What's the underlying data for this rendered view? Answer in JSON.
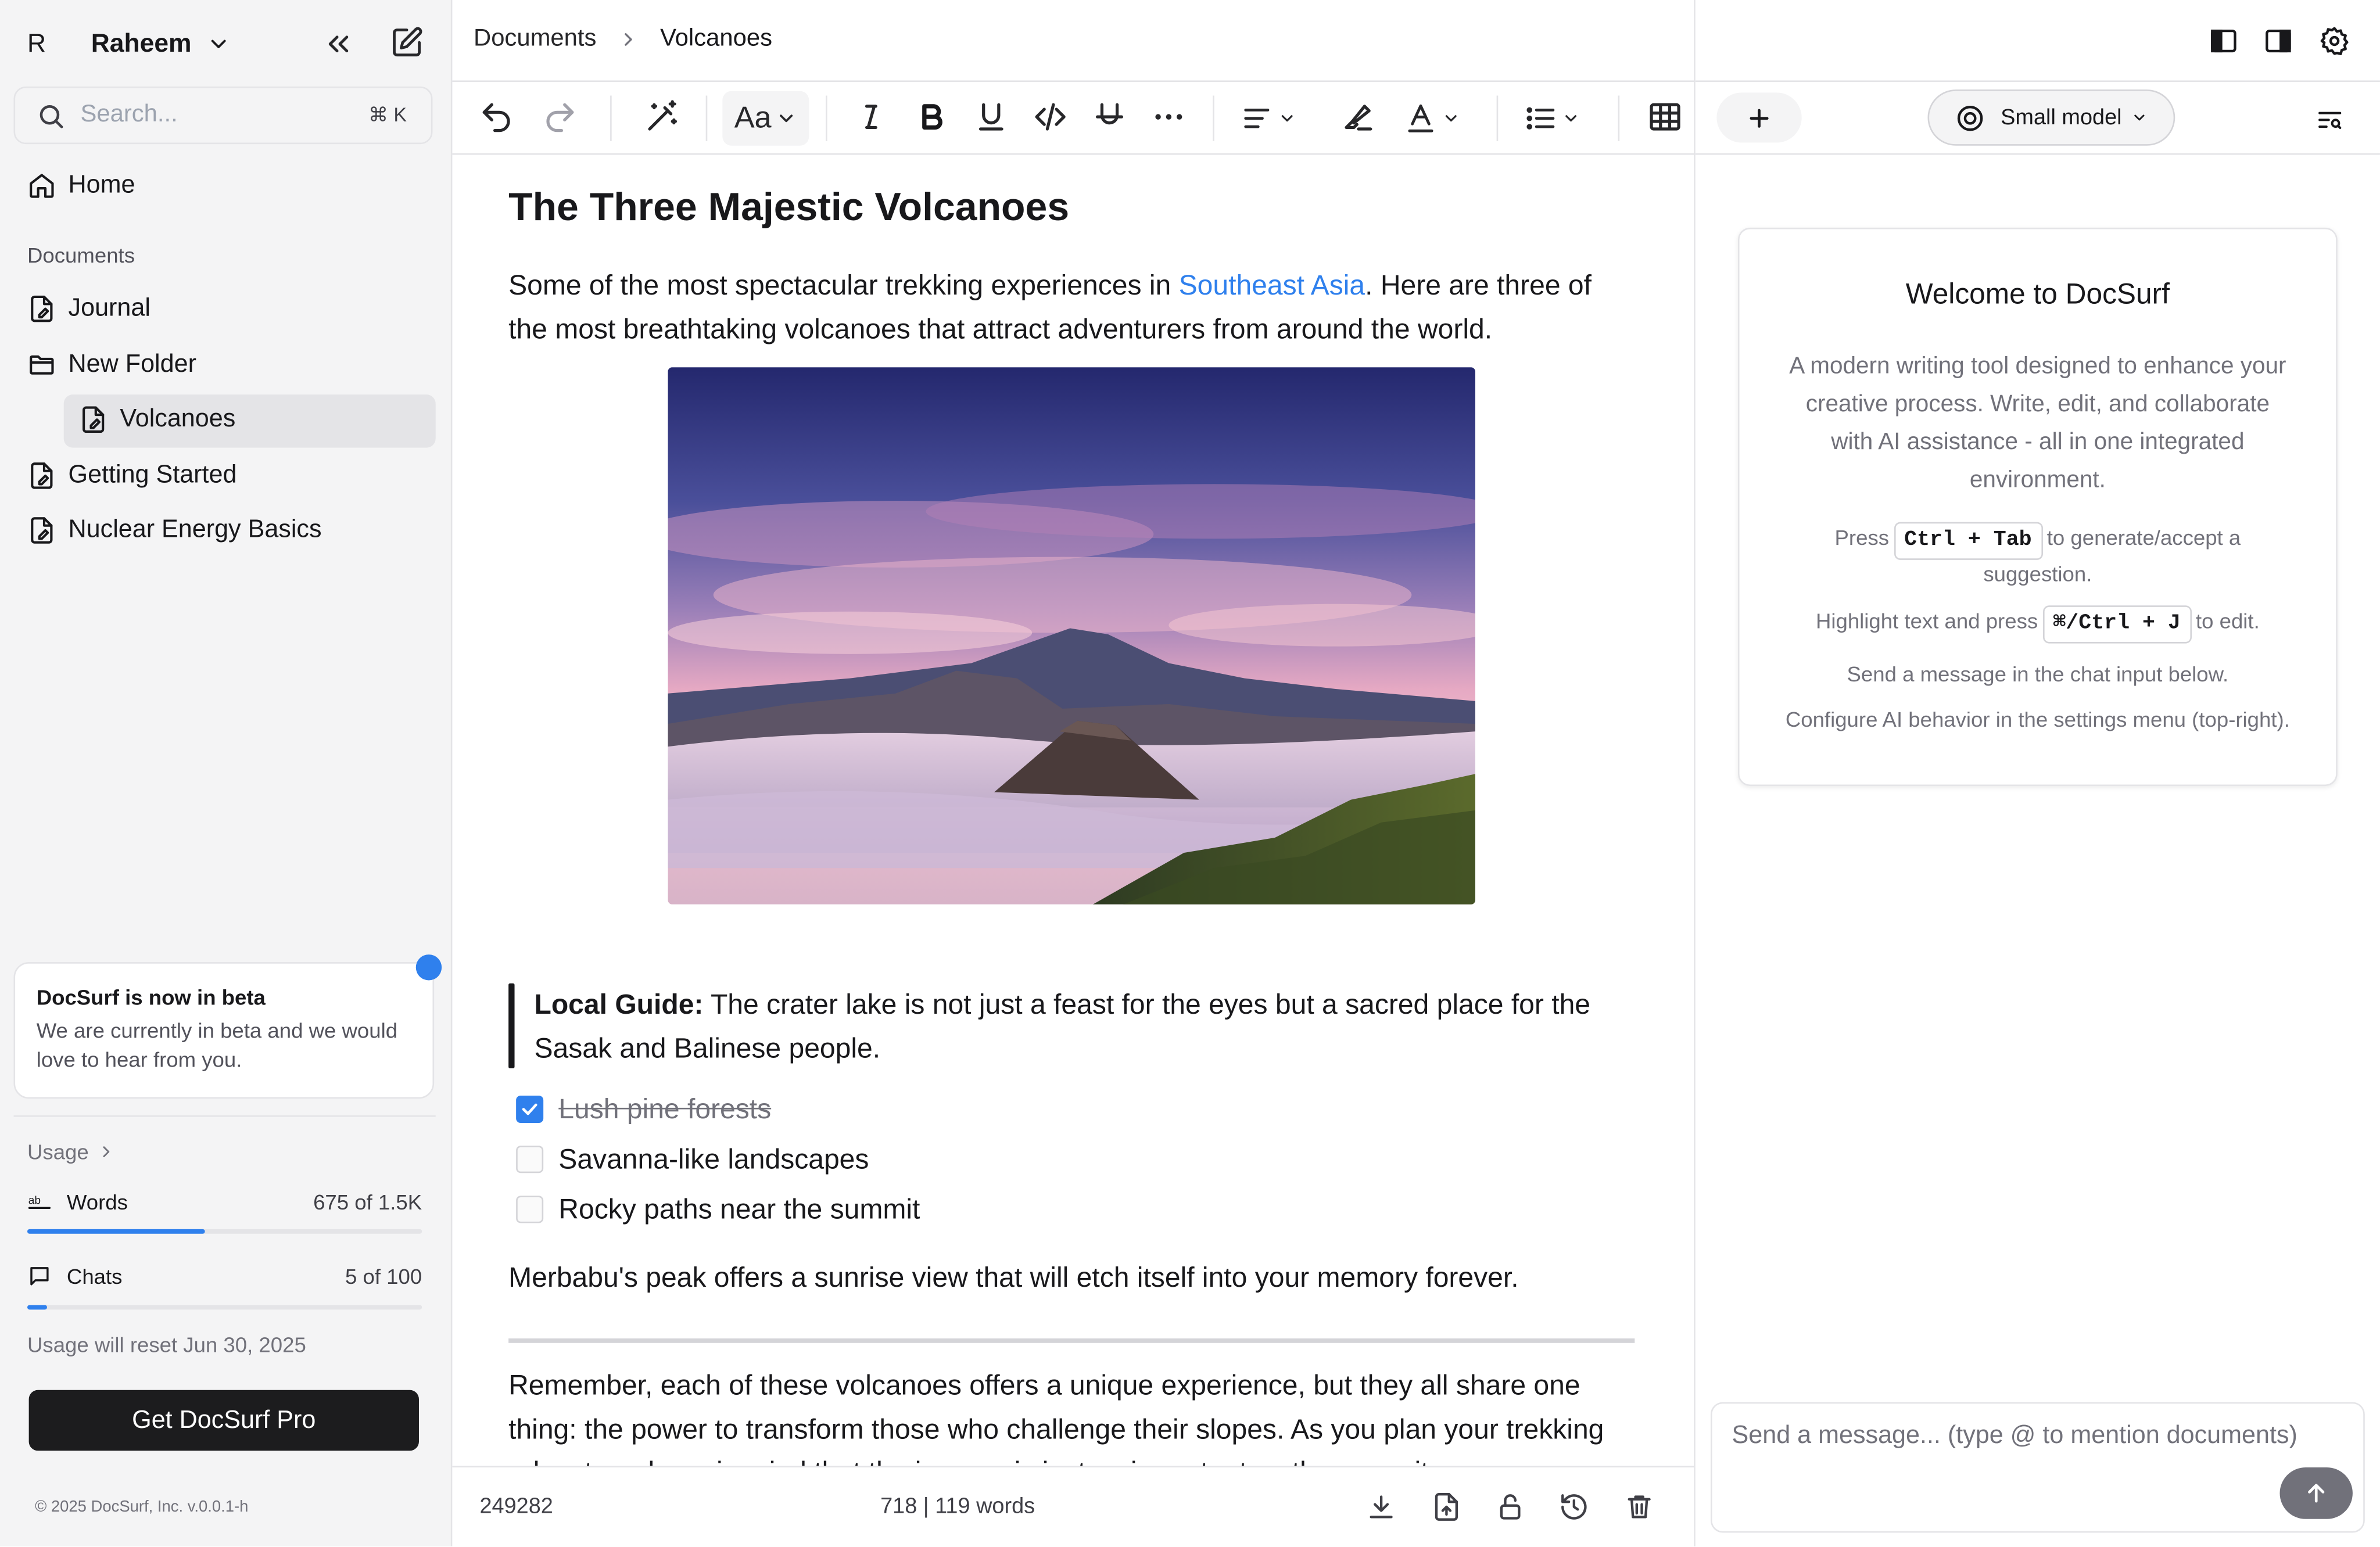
{
  "sidebar": {
    "avatar_letter": "R",
    "user_name": "Raheem",
    "search_placeholder": "Search...",
    "search_shortcut": "⌘ K",
    "home_label": "Home",
    "documents_label": "Documents",
    "items": [
      {
        "label": "Journal"
      },
      {
        "label": "New Folder"
      },
      {
        "label": "Volcanoes"
      },
      {
        "label": "Getting Started"
      },
      {
        "label": "Nuclear Energy Basics"
      }
    ],
    "beta": {
      "title": "DocSurf is now in beta",
      "text": "We are currently in beta and we would love to hear from you."
    },
    "usage": {
      "label": "Usage",
      "words_label": "Words",
      "words_value": "675 of 1.5K",
      "words_fraction": 0.45,
      "chats_label": "Chats",
      "chats_value": "5 of 100",
      "chats_fraction": 0.05,
      "reset_text": "Usage will reset Jun 30, 2025"
    },
    "pro_button": "Get DocSurf Pro",
    "copyright": "© 2025 DocSurf, Inc. v.0.0.1-h"
  },
  "main": {
    "breadcrumb": [
      "Documents",
      "Volcanoes"
    ],
    "toolbar": {
      "font_button": "Aa"
    },
    "doc": {
      "title": "The Three Majestic Volcanoes",
      "intro_before": "Some of the most spectacular trekking experiences in ",
      "intro_link": "Southeast Asia",
      "intro_after": ". Here are three of the most breathtaking volcanoes that attract adventurers from around the world.",
      "quote_bold": "Local Guide:",
      "quote_text": " The crater lake is not just a feast for the eyes but a sacred place for the Sasak and Balinese people.",
      "tasks": [
        {
          "label": "Lush pine forests",
          "checked": true
        },
        {
          "label": "Savanna-like landscapes",
          "checked": false
        },
        {
          "label": "Rocky paths near the summit",
          "checked": false
        }
      ],
      "summit_text": "Merbabu's peak offers a sunrise view that will etch itself into your memory forever.",
      "closing_text": "Remember, each of these volcanoes offers a unique experience, but they all share one thing: the power to transform those who challenge their slopes. As you plan your trekking adventure, keep in mind that the journey is just as important as the summit."
    },
    "status": {
      "doc_id": "249282",
      "counts": "718 | 119 words"
    }
  },
  "right_panel": {
    "model_label": "Small model",
    "welcome": {
      "title": "Welcome to DocSurf",
      "description": "A modern writing tool designed to enhance your creative process. Write, edit, and collaborate with AI assistance - all in one integrated environment.",
      "tip1_before": "Press",
      "tip1_kbd": "Ctrl + Tab",
      "tip1_after": "to generate/accept a suggestion.",
      "tip2_before": "Highlight text and press",
      "tip2_kbd": "⌘/Ctrl + J",
      "tip2_after": "to edit.",
      "tip3": "Send a message in the chat input below.",
      "tip4": "Configure AI behavior in the settings menu (top-right)."
    },
    "chat_placeholder": "Send a message... (type @ to mention documents)"
  },
  "colors": {
    "accent": "#2f80ed",
    "link": "#2f80ed",
    "dark_button": "#1c1c1e",
    "sidebar_bg": "#f4f4f5"
  },
  "icons": [
    "chevron-down-icon",
    "collapse-sidebar-icon",
    "new-document-icon",
    "search-icon",
    "home-icon",
    "document-icon",
    "folder-icon",
    "undo-icon",
    "redo-icon",
    "magic-wand-icon",
    "italic-icon",
    "bold-icon",
    "underline-icon",
    "code-icon",
    "strikethrough-icon",
    "more-icon",
    "align-left-icon",
    "highlighter-icon",
    "text-color-icon",
    "list-icon",
    "table-icon",
    "download-icon",
    "export-icon",
    "unlock-icon",
    "history-icon",
    "trash-icon",
    "panel-left-icon",
    "panel-right-icon",
    "settings-icon",
    "plus-icon",
    "model-icon",
    "menu-search-icon",
    "arrow-up-icon",
    "check-icon",
    "words-icon",
    "chat-icon"
  ]
}
